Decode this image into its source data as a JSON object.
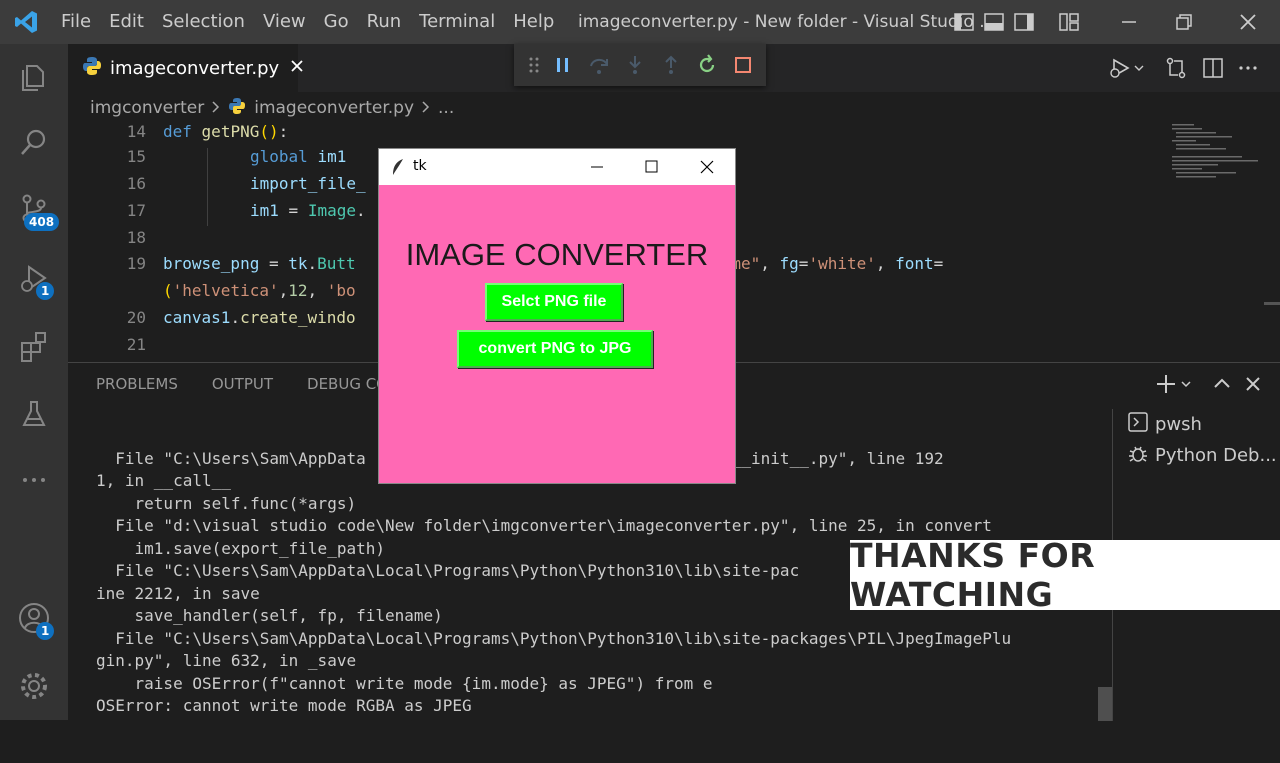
{
  "menu": [
    "File",
    "Edit",
    "Selection",
    "View",
    "Go",
    "Run",
    "Terminal",
    "Help"
  ],
  "window_title": "imageconverter.py - New folder - Visual Studio ...",
  "activity": {
    "scm_badge": "408",
    "debug_badge": "1",
    "account_badge": "1"
  },
  "tab": {
    "label": "imageconverter.py"
  },
  "breadcrumb": {
    "folder": "imgconverter",
    "file": "imageconverter.py",
    "more": "..."
  },
  "editor": {
    "line_numbers": [
      "14",
      "15",
      "16",
      "17",
      "18",
      "19",
      "",
      "20",
      "21"
    ]
  },
  "panel": {
    "tabs": [
      "PROBLEMS",
      "OUTPUT",
      "DEBUG CON"
    ],
    "terminal_lines": [
      "  File \"C:\\Users\\Sam\\AppData                          lib\\tkinter\\__init__.py\", line 192",
      "1, in __call__",
      "    return self.func(*args)",
      "  File \"d:\\visual studio code\\New folder\\imgconverter\\imageconverter.py\", line 25, in convert",
      "    im1.save(export_file_path)",
      "  File \"C:\\Users\\Sam\\AppData\\Local\\Programs\\Python\\Python310\\lib\\site-pac",
      "ine 2212, in save",
      "    save_handler(self, fp, filename)",
      "  File \"C:\\Users\\Sam\\AppData\\Local\\Programs\\Python\\Python310\\lib\\site-packages\\PIL\\JpegImagePlu",
      "gin.py\", line 632, in _save",
      "    raise OSError(f\"cannot write mode {im.mode} as JPEG\") from e",
      "OSError: cannot write mode RGBA as JPEG"
    ],
    "terminals": [
      "pwsh",
      "Python Deb..."
    ]
  },
  "tk": {
    "title": "tk",
    "heading": "IMAGE CONVERTER",
    "select_button": "Selct PNG file",
    "convert_button": "convert PNG to JPG",
    "bg_color": "#ff69b4",
    "button_color": "#00ff00"
  },
  "overlay": {
    "text": "THANKS FOR WATCHING"
  }
}
